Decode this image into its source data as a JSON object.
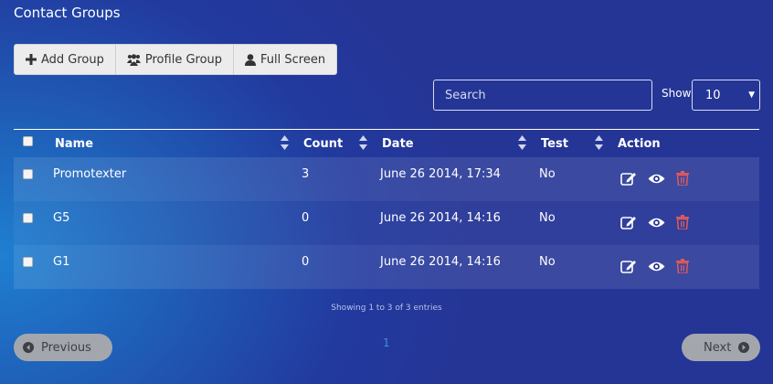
{
  "page": {
    "title": "Contact Groups"
  },
  "toolbar": {
    "add_group": "Add Group",
    "profile_group": "Profile Group",
    "full_screen": "Full Screen"
  },
  "search": {
    "placeholder": "Search",
    "value": ""
  },
  "length": {
    "label": "Show",
    "value": "10"
  },
  "table": {
    "columns": [
      "Name",
      "Count",
      "Date",
      "Test",
      "Action"
    ],
    "rows": [
      {
        "name": "Promotexter",
        "count": "3",
        "date": "June 26 2014, 17:34",
        "test": "No"
      },
      {
        "name": "G5",
        "count": "0",
        "date": "June 26 2014, 14:16",
        "test": "No"
      },
      {
        "name": "G1",
        "count": "0",
        "date": "June 26 2014, 14:16",
        "test": "No"
      }
    ]
  },
  "info": "Showing 1 to 3 of 3 entries",
  "pagination": {
    "previous": "Previous",
    "next": "Next",
    "current_page": "1"
  },
  "icons": {
    "add": "plus-icon",
    "profile": "users-icon",
    "fullscreen": "user-icon",
    "edit": "edit-icon",
    "view": "eye-icon",
    "delete": "trash-icon"
  },
  "colors": {
    "delete": "#e05a5a",
    "page_link": "#3a8ee6",
    "pill": "#a3a7ad"
  }
}
